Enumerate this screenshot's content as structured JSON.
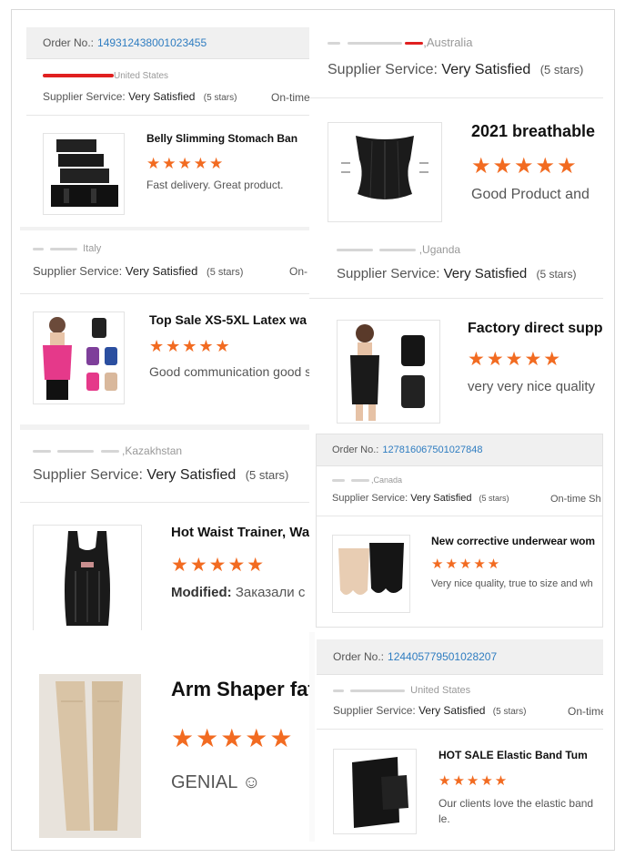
{
  "c1": {
    "order_label": "Order No.:",
    "order_no": "149312438001023455",
    "location": "United States",
    "service_label": "Supplier Service:",
    "service_value": "Very Satisfied",
    "service_stars": "(5 stars)",
    "ontime": "On-time",
    "title": "Belly Slimming Stomach Ban",
    "stars": "★★★★★",
    "review": "Fast delivery. Great product."
  },
  "c2": {
    "location": ",Australia",
    "service_label": "Supplier Service:",
    "service_value": "Very Satisfied",
    "service_stars": "(5 stars)"
  },
  "c3": {
    "title": "2021 breathable",
    "stars": "★★★★★",
    "review": "Good Product and"
  },
  "c4": {
    "location": "Italy",
    "service_label": "Supplier Service:",
    "service_value": "Very Satisfied",
    "service_stars": "(5 stars)",
    "ontime": "On-",
    "title": "Top Sale XS-5XL Latex wa",
    "stars": "★★★★★",
    "review": "Good communication good s"
  },
  "c5": {
    "location": ",Uganda",
    "service_label": "Supplier Service:",
    "service_value": "Very Satisfied",
    "service_stars": "(5 stars)",
    "title": "Factory direct supp",
    "stars": "★★★★★",
    "review": "very very nice quality"
  },
  "c6": {
    "location": ",Kazakhstan",
    "service_label": "Supplier Service:",
    "service_value": "Very Satisfied",
    "service_stars": "(5 stars)",
    "title": "Hot Waist Trainer, Wa",
    "stars": "★★★★★",
    "review_prefix": "Modified:",
    "review": "Заказали с"
  },
  "c7": {
    "order_label": "Order No.:",
    "order_no": "127816067501027848",
    "location": ",Canada",
    "service_label": "Supplier Service:",
    "service_value": "Very Satisfied",
    "service_stars": "(5 stars)",
    "ontime": "On-time Sh",
    "title": "New corrective underwear wom",
    "stars": "★★★★★",
    "review": "Very nice quality, true to size and wh"
  },
  "c8": {
    "title": "Arm Shaper fat bur",
    "stars": "★★★★★",
    "review": "GENIAL ☺"
  },
  "c9": {
    "order_label": "Order No.:",
    "order_no": "124405779501028207",
    "location": "United States",
    "service_label": "Supplier Service:",
    "service_value": "Very Satisfied",
    "service_stars": "(5 stars)",
    "ontime": "On-time",
    "title": "HOT SALE Elastic Band Tum",
    "stars": "★★★★★",
    "review_line1": "Our clients love the elastic band",
    "review_line2": "le."
  },
  "colors": {
    "accent_star": "#f26b21",
    "order_link": "#2f7dc1",
    "redaction": "#e02020"
  }
}
